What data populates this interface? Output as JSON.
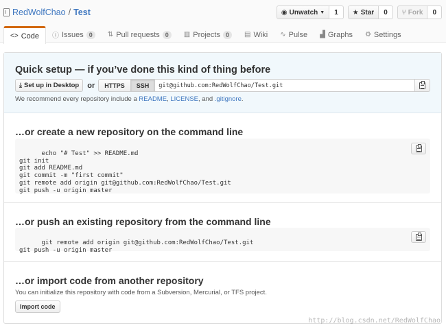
{
  "header": {
    "owner": "RedWolfChao",
    "separator": "/",
    "repo": "Test",
    "actions": [
      {
        "label": "Unwatch",
        "icon": "eye-icon",
        "count": "1"
      },
      {
        "label": "Star",
        "icon": "star-icon",
        "count": "0"
      },
      {
        "label": "Fork",
        "icon": "fork-icon",
        "count": "0"
      }
    ]
  },
  "tabs": [
    {
      "label": "Code",
      "icon": "code-icon",
      "count": null
    },
    {
      "label": "Issues",
      "icon": "issue-icon",
      "count": "0"
    },
    {
      "label": "Pull requests",
      "icon": "pull-request-icon",
      "count": "0"
    },
    {
      "label": "Projects",
      "icon": "project-icon",
      "count": "0"
    },
    {
      "label": "Wiki",
      "icon": "book-icon",
      "count": null
    },
    {
      "label": "Pulse",
      "icon": "pulse-icon",
      "count": null
    },
    {
      "label": "Graphs",
      "icon": "graph-icon",
      "count": null
    },
    {
      "label": "Settings",
      "icon": "gear-icon",
      "count": null
    }
  ],
  "quick_setup": {
    "title": "Quick setup — if you’ve done this kind of thing before",
    "desktop_button": "Set up in Desktop",
    "or": "or",
    "https": "HTTPS",
    "ssh": "SSH",
    "url": "git@github.com:RedWolfChao/Test.git",
    "recommend_prefix": "We recommend every repository include a ",
    "readme": "README",
    "comma": ", ",
    "license": "LICENSE",
    "and": ", and ",
    "gitignore": ".gitignore",
    "period": "."
  },
  "new_repo": {
    "title": "…or create a new repository on the command line",
    "code": "echo \"# Test\" >> README.md\ngit init\ngit add README.md\ngit commit -m \"first commit\"\ngit remote add origin git@github.com:RedWolfChao/Test.git\ngit push -u origin master"
  },
  "push_repo": {
    "title": "…or push an existing repository from the command line",
    "code": "git remote add origin git@github.com:RedWolfChao/Test.git\ngit push -u origin master"
  },
  "import_repo": {
    "title": "…or import code from another repository",
    "description": "You can initialize this repository with code from a Subversion, Mercurial, or TFS project.",
    "button": "Import code"
  },
  "watermark": "http://blog.csdn.net/RedWolfChao",
  "colors": {
    "accent": "#d26911",
    "link": "#4078c0",
    "quick_bg": "#f1f8fc"
  }
}
